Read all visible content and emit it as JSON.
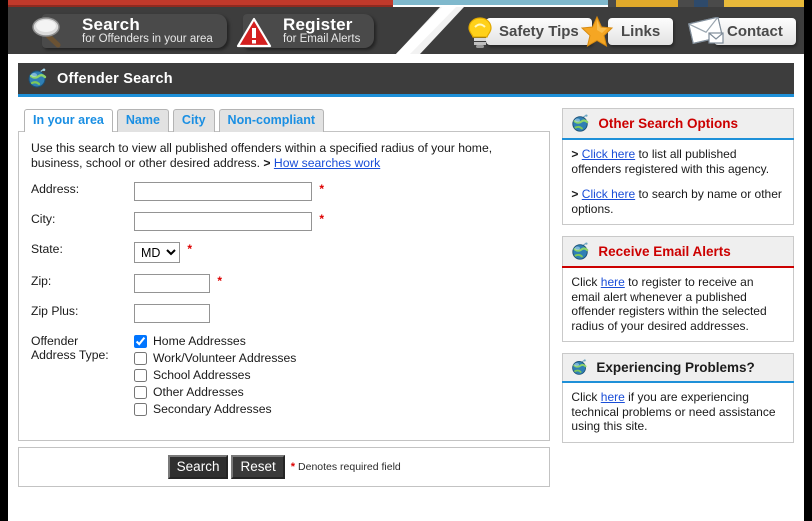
{
  "nav": {
    "items": [
      {
        "id": "search",
        "icon": "magnifier-icon",
        "line1": "Search",
        "line2": "for Offenders in your area",
        "style": "dark"
      },
      {
        "id": "register",
        "icon": "warning-triangle-icon",
        "line1": "Register",
        "line2": "for Email Alerts",
        "style": "dark"
      },
      {
        "id": "safety",
        "icon": "lightbulb-icon",
        "label": "Safety Tips",
        "style": "light"
      },
      {
        "id": "links",
        "icon": "star-icon",
        "label": "Links",
        "style": "light"
      },
      {
        "id": "contact",
        "icon": "envelope-icon",
        "label": "Contact",
        "style": "light"
      }
    ]
  },
  "titlebar": {
    "icon": "globe-icon",
    "title": "Offender Search"
  },
  "tabs": [
    {
      "label": "In your area",
      "active": true
    },
    {
      "label": "Name",
      "active": false
    },
    {
      "label": "City",
      "active": false
    },
    {
      "label": "Non-compliant",
      "active": false
    }
  ],
  "form": {
    "intro_text": "Use this search to view all published offenders within a specified radius of your home, business, school or other desired address.",
    "intro_arrow": ">",
    "intro_link": "How searches work",
    "fields": {
      "address": {
        "label": "Address:",
        "value": "",
        "required_mark": "*"
      },
      "city": {
        "label": "City:",
        "value": "",
        "required_mark": "*"
      },
      "state": {
        "label": "State:",
        "value": "MD",
        "required_mark": "*",
        "options": [
          "MD"
        ]
      },
      "zip": {
        "label": "Zip:",
        "value": "",
        "required_mark": "*"
      },
      "zipplus": {
        "label": "Zip Plus:",
        "value": ""
      }
    },
    "address_type": {
      "label_line1": "Offender",
      "label_line2": "Address Type:",
      "options": [
        {
          "label": "Home Addresses",
          "checked": true
        },
        {
          "label": "Work/Volunteer Addresses",
          "checked": false
        },
        {
          "label": "School Addresses",
          "checked": false
        },
        {
          "label": "Other Addresses",
          "checked": false
        },
        {
          "label": "Secondary Addresses",
          "checked": false
        }
      ]
    },
    "buttons": {
      "search": "Search",
      "reset": "Reset",
      "denotes_mark": "*",
      "denotes_text": "Denotes required field"
    }
  },
  "sidebar": {
    "panels": [
      {
        "id": "other-search-options",
        "icon": "globe-icon",
        "title": "Other Search Options",
        "title_color": "#cc0000",
        "rule_color": "#1e90d8",
        "paragraphs": [
          {
            "arrow": ">",
            "link": "Click here",
            "text": " to list all published offenders registered with this agency."
          },
          {
            "arrow": ">",
            "link": "Click here",
            "text": " to search by name or other options."
          }
        ]
      },
      {
        "id": "receive-email-alerts",
        "icon": "globe-icon",
        "title": "Receive Email Alerts",
        "title_color": "#cc0000",
        "rule_color": "#cc0000",
        "paragraphs": [
          {
            "prefix": "Click ",
            "link": "here",
            "text": " to register to receive an email alert whenever a published offender registers within the selected radius of your desired addresses."
          }
        ]
      },
      {
        "id": "experiencing-problems",
        "icon": "globe-icon",
        "title": "Experiencing Problems?",
        "title_color": "#1c1c1c",
        "rule_color": "#1e90d8",
        "paragraphs": [
          {
            "prefix": "Click ",
            "link": "here",
            "text": " if you are experiencing technical problems or need assistance using this site."
          }
        ]
      }
    ]
  },
  "colors": {
    "nav_dark": "#3d3d3d",
    "accent_blue": "#1e90d8",
    "accent_red": "#cc0000",
    "link_blue": "#1a4ed8",
    "tab_blue": "#1a8fe3"
  }
}
